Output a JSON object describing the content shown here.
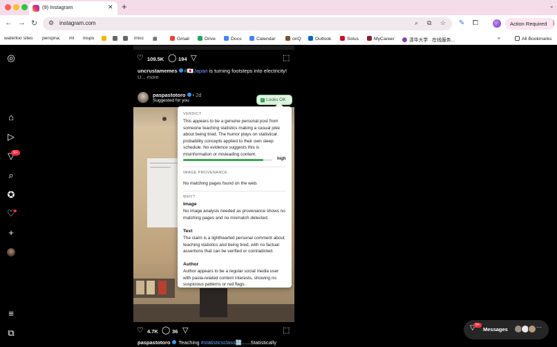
{
  "browser": {
    "tab_title": "(9) Instagram",
    "tab_close": "✕",
    "new_tab": "+",
    "url": "instagram.com",
    "action_required": "Action Required",
    "bookmarks": [
      "waterloo sites",
      "perspna;",
      "ml",
      "inspo",
      "misc",
      "Gmail",
      "Drive",
      "Docs",
      "Calendar",
      "onQ",
      "Outlook",
      "Solus",
      "MyCareer",
      "清华大学 · 在线服务...",
      "All Bookmarks"
    ],
    "bookmarks_more": "»"
  },
  "feed": {
    "post1": {
      "likes": "109.5K",
      "comments": "194",
      "author": "uncrustamemes",
      "hashtag": "#🇯🇵Japan",
      "caption": "is turning footsteps into electricity!",
      "more": "U... more"
    },
    "post2": {
      "author": "paspastotoro",
      "time": "• 2d",
      "subtitle": "Suggested for you",
      "likes": "4.7K",
      "comments": "36",
      "caption_author": "paspastotoro",
      "caption_text": "Teaching",
      "caption_hashtag": "#statisticsclass",
      "caption_rest": "🔢......Statistically"
    }
  },
  "verdict_panel": {
    "badge": "Looks OK",
    "verdict_heading": "VERDICT",
    "verdict_text": "This appears to be a genuine personal post from someone teaching statistics making a casual joke about being tired. The humor plays on statistical probability concepts applied to their own sleep schedule. No evidence suggests this is misinformation or misleading content.",
    "confidence_label": "high",
    "confidence_fraction": 0.9,
    "provenance_heading": "IMAGE PROVENANCE",
    "provenance_text": "No matching pages found on the web.",
    "why_heading": "WHY?",
    "image_heading": "Image",
    "image_text": "No image analysis needed as provenance shows no matching pages and no mismatch detected.",
    "text_heading": "Text",
    "text_text": "The claim is a lighthearted personal comment about teaching statistics and being tired, with no factual assertions that can be verified or contradicted.",
    "author_heading": "Author",
    "author_text": "Author appears to be a regular social media user with pasta-related content interests, showing no suspicious patterns or red flags."
  },
  "sidebar": {
    "notification_badge": "9+"
  },
  "messages": {
    "label": "Messages",
    "badge": "9+",
    "more": "···"
  },
  "colors": {
    "accent_blue": "#3897f0",
    "badge_red": "#ff3040",
    "ok_green": "#3aa655"
  }
}
